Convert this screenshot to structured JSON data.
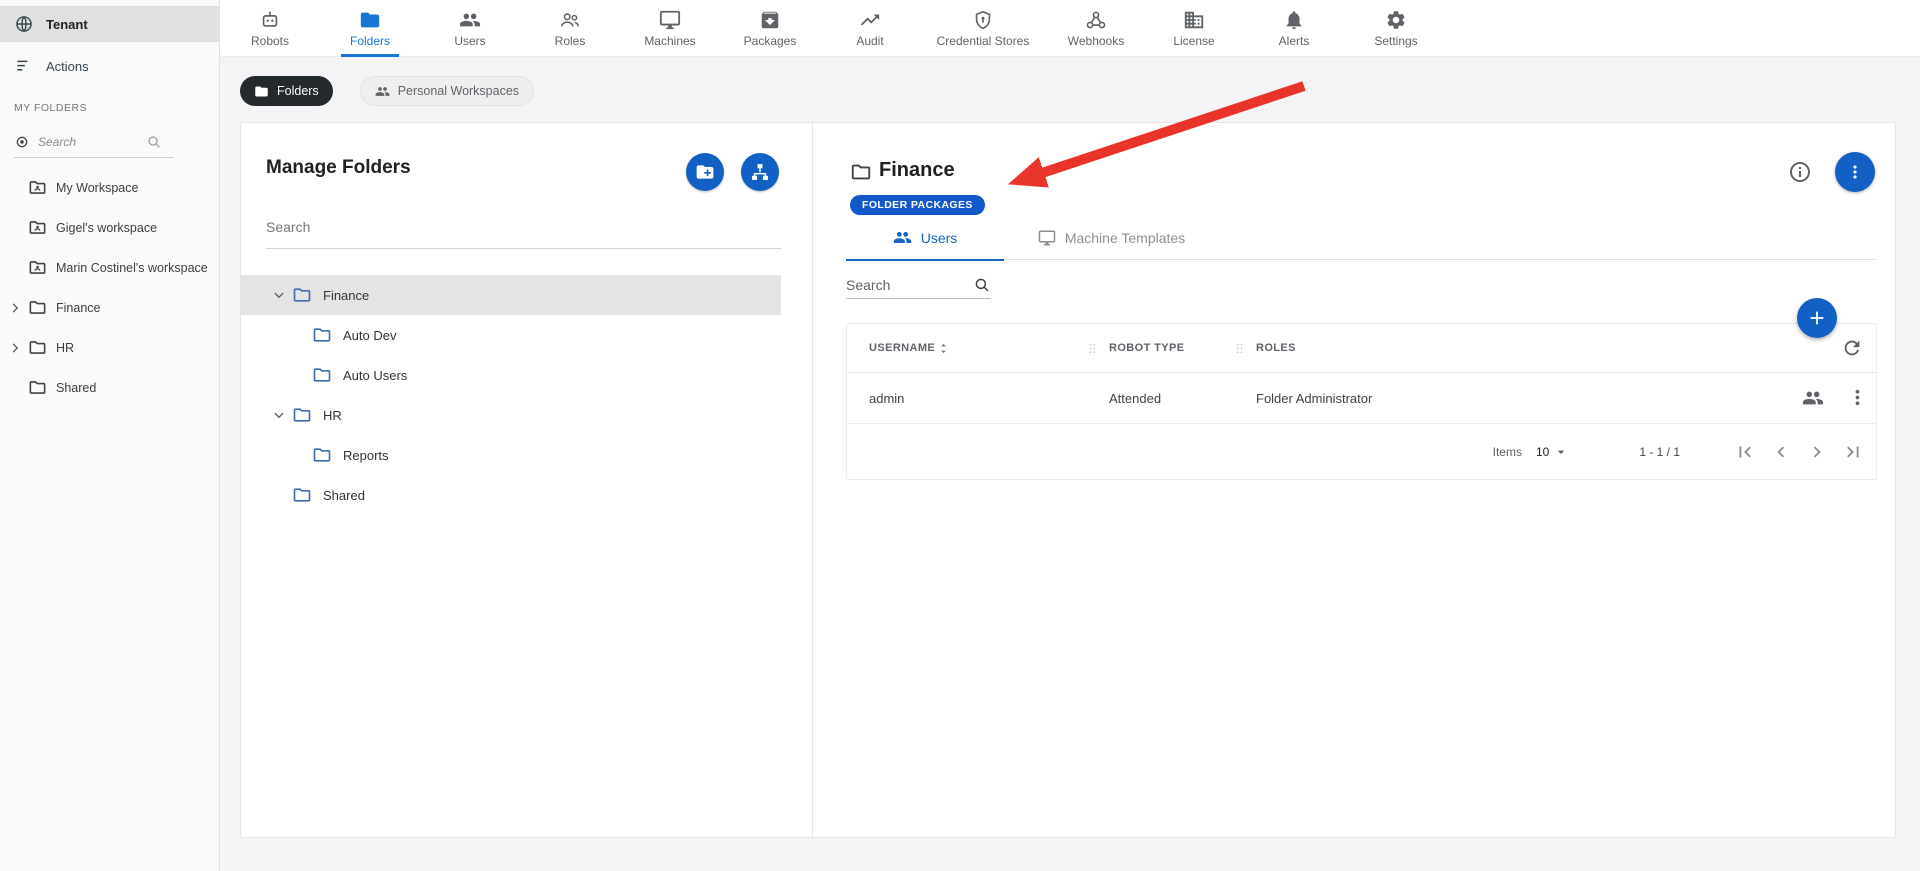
{
  "colors": {
    "accent_blue": "#1360c4",
    "active_tab_blue": "#1976d2",
    "badge_blue": "#1258cb",
    "selected_gray": "#e0e0e0",
    "annotation_red": "#e8342b",
    "dark_chip": "#24292e"
  },
  "sidebar": {
    "tenant_label": "Tenant",
    "actions_label": "Actions",
    "section_label": "MY FOLDERS",
    "search_placeholder": "Search",
    "items": [
      {
        "label": "My Workspace"
      },
      {
        "label": "Gigel's workspace"
      },
      {
        "label": "Marin Costinel's workspace"
      },
      {
        "label": "Finance"
      },
      {
        "label": "HR"
      },
      {
        "label": "Shared"
      }
    ]
  },
  "topnav": {
    "active_tab": "Folders",
    "tabs": [
      {
        "label": "Robots"
      },
      {
        "label": "Folders"
      },
      {
        "label": "Users"
      },
      {
        "label": "Roles"
      },
      {
        "label": "Machines"
      },
      {
        "label": "Packages"
      },
      {
        "label": "Audit"
      },
      {
        "label": "Credential Stores"
      },
      {
        "label": "Webhooks"
      },
      {
        "label": "License"
      },
      {
        "label": "Alerts"
      },
      {
        "label": "Settings"
      }
    ]
  },
  "toggle_chips": {
    "folders": "Folders",
    "personal_workspaces": "Personal Workspaces"
  },
  "manage_folders": {
    "title": "Manage Folders",
    "search_placeholder": "Search",
    "tree": [
      {
        "label": "Finance",
        "level": 0,
        "expanded": true,
        "selected": true
      },
      {
        "label": "Auto Dev",
        "level": 1
      },
      {
        "label": "Auto Users",
        "level": 1
      },
      {
        "label": "HR",
        "level": 0,
        "expanded": true
      },
      {
        "label": "Reports",
        "level": 1
      },
      {
        "label": "Shared",
        "level": 0
      }
    ]
  },
  "folder_detail": {
    "title": "Finance",
    "badge": "FOLDER PACKAGES",
    "tabs": {
      "users": "Users",
      "machine_templates": "Machine Templates"
    },
    "search_placeholder": "Search",
    "table": {
      "headers": {
        "username": "USERNAME",
        "robot_type": "ROBOT TYPE",
        "roles": "ROLES"
      },
      "rows": [
        {
          "username": "admin",
          "robot_type": "Attended",
          "roles": "Folder Administrator"
        }
      ]
    },
    "pagination": {
      "items_label": "Items",
      "page_size": "10",
      "range": "1 - 1 / 1"
    }
  }
}
